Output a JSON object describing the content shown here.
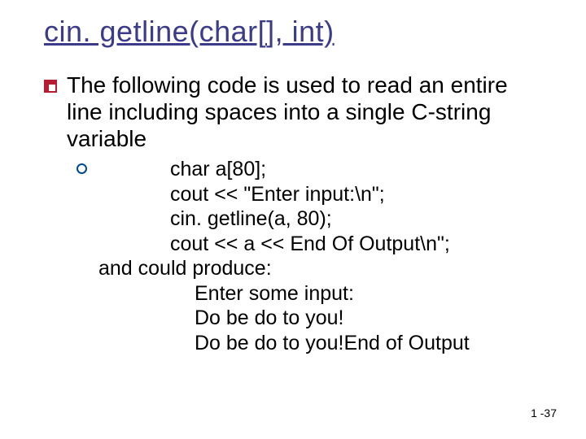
{
  "title": "cin. getline(char[], int)",
  "bullet": "The following code is used to read an entire line including spaces into a single C-string variable",
  "code": {
    "l1": "char a[80];",
    "l2": "cout << \"Enter input:\\n\";",
    "l3": "cin. getline(a, 80);",
    "l4": "cout << a << End Of Output\\n\";",
    "prod": "and could produce:",
    "o1": "Enter some input:",
    "o2": "Do be do to you!",
    "o3": "Do be do to you!End of Output"
  },
  "pagenum": "1 -37"
}
